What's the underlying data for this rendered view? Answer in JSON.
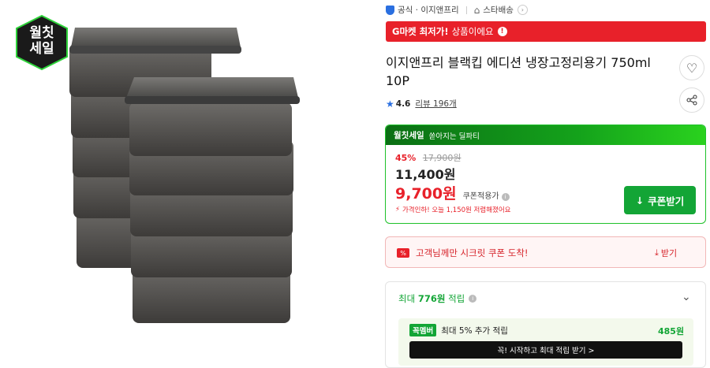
{
  "badge": {
    "line1": "월칫",
    "line2": "세일"
  },
  "seller": {
    "official_label": "공식 · 이지앤프리",
    "delivery_label": "스타배송"
  },
  "gmarket_banner": {
    "bold": "G마켓 최저가!",
    "text": "상품이에요"
  },
  "product": {
    "title": "이지앤프리 블랙킵 에디션 냉장고정리용기 750ml 10P"
  },
  "rating": {
    "score": "4.6",
    "review_label": "리뷰 196개"
  },
  "promo": {
    "header_brand": "월칫세일",
    "header_sub": "쏟아지는 딜파티",
    "discount_rate": "45%",
    "original_price": "17,900원",
    "sale_price": "11,400원",
    "coupon_price": "9,700원",
    "coupon_applied": "쿠폰적용가",
    "price_drop_note": "가격인하! 오늘 1,150원 저렴해졌어요",
    "coupon_button": "쿠폰받기"
  },
  "secret": {
    "text": "고객님께만 시크릿 쿠폰 도착!",
    "button": "받기"
  },
  "points": {
    "prefix": "최대 ",
    "amount": "776원",
    "suffix": " 적립"
  },
  "member": {
    "brand": "꼭멤버",
    "text": "최대 5% 추가 적립",
    "amount": "485원",
    "start_label": "꼭! 시작하고 최대 적립 받기 >"
  },
  "colors": {
    "red": "#e8212a",
    "green": "#13a536",
    "dark_green": "#0b6f14"
  }
}
